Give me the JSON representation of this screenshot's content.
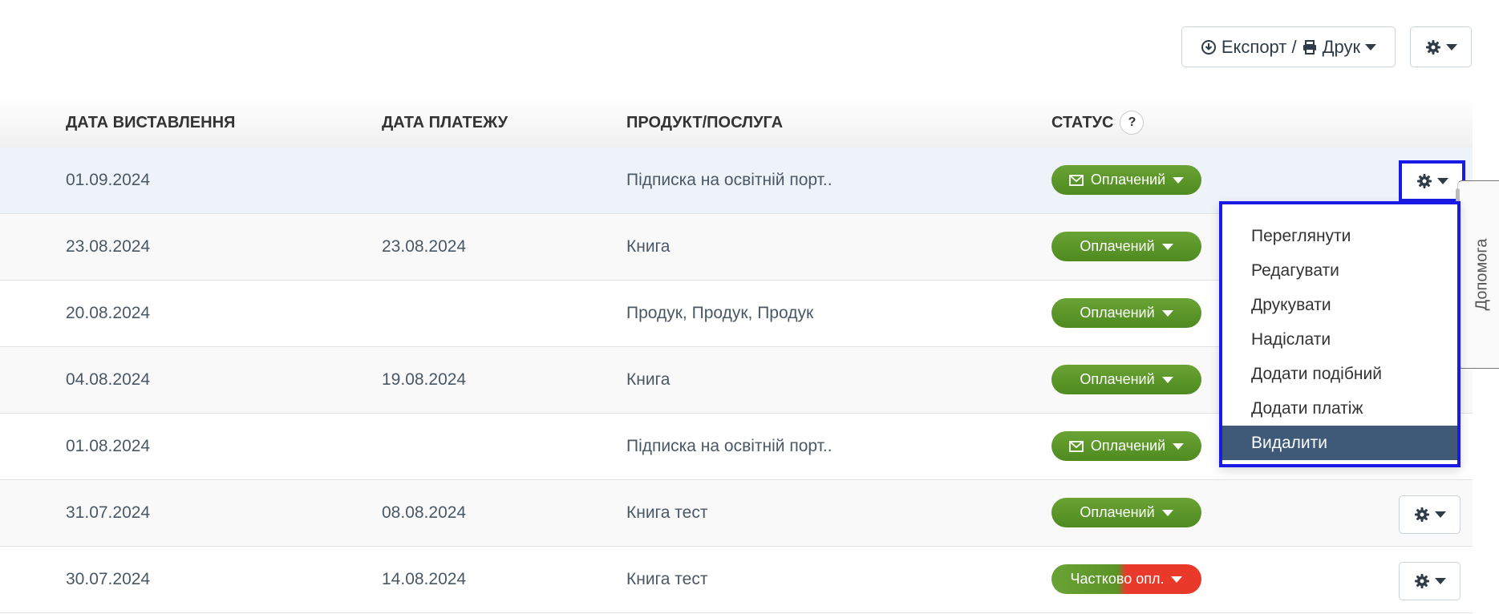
{
  "toolbar": {
    "export_label": "Експорт / ",
    "print_label": "Друк"
  },
  "table": {
    "headers": {
      "date_issued": "ДАТА ВИСТАВЛЕННЯ",
      "date_paid": "ДАТА ПЛАТЕЖУ",
      "product": "ПРОДУКТ/ПОСЛУГА",
      "status": "СТАТУС",
      "status_help": "?"
    },
    "rows": [
      {
        "date_issued": "01.09.2024",
        "date_paid": "",
        "product": "Підписка на освітній порт..",
        "status": "Оплачений",
        "status_type": "paid",
        "has_mail_icon": true,
        "highlighted": true
      },
      {
        "date_issued": "23.08.2024",
        "date_paid": "23.08.2024",
        "product": "Книга",
        "status": "Оплачений",
        "status_type": "paid",
        "has_mail_icon": false
      },
      {
        "date_issued": "20.08.2024",
        "date_paid": "",
        "product": "Продук, Продук, Продук",
        "status": "Оплачений",
        "status_type": "paid",
        "has_mail_icon": false
      },
      {
        "date_issued": "04.08.2024",
        "date_paid": "19.08.2024",
        "product": "Книга",
        "status": "Оплачений",
        "status_type": "paid",
        "has_mail_icon": false
      },
      {
        "date_issued": "01.08.2024",
        "date_paid": "",
        "product": "Підписка на освітній порт..",
        "status": "Оплачений",
        "status_type": "paid",
        "has_mail_icon": true
      },
      {
        "date_issued": "31.07.2024",
        "date_paid": "08.08.2024",
        "product": "Книга тест",
        "status": "Оплачений",
        "status_type": "paid",
        "has_mail_icon": false
      },
      {
        "date_issued": "30.07.2024",
        "date_paid": "14.08.2024",
        "product": "Книга тест",
        "status": "Частково опл.",
        "status_type": "partial",
        "has_mail_icon": false
      }
    ]
  },
  "row_menu": {
    "items": [
      "Переглянути",
      "Редагувати",
      "Друкувати",
      "Надіслати",
      "Додати подібний",
      "Додати платіж",
      "Видалити"
    ],
    "active_index": 6
  },
  "help_tab": {
    "label": "Допомога"
  },
  "colors": {
    "status_paid": "#5b9426",
    "status_partial": "#e8392b",
    "highlight_row": "#eef3f9",
    "menu_active": "#3f5a78",
    "focus_outline": "#1a1ae6"
  },
  "icons": {
    "export": "download-circle-icon",
    "print": "print-icon",
    "settings": "gear-icon",
    "mail": "envelope-icon",
    "caret": "caret-down-icon"
  }
}
